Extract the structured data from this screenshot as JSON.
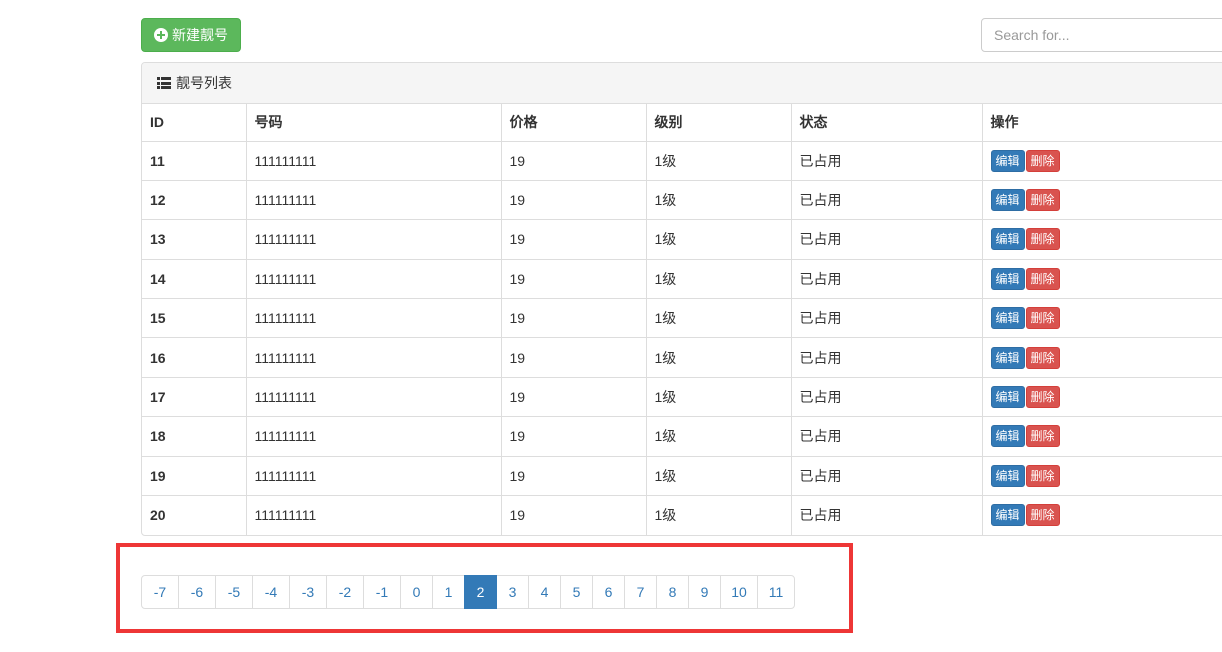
{
  "toolbar": {
    "new_button_label": "新建靓号",
    "search_placeholder": "Search for..."
  },
  "panel": {
    "title": "靓号列表"
  },
  "table": {
    "columns": [
      "ID",
      "号码",
      "价格",
      "级别",
      "状态",
      "操作"
    ],
    "rows": [
      {
        "id": "11",
        "number": "111111111",
        "price": "19",
        "level": "1级",
        "status": "已占用"
      },
      {
        "id": "12",
        "number": "111111111",
        "price": "19",
        "level": "1级",
        "status": "已占用"
      },
      {
        "id": "13",
        "number": "111111111",
        "price": "19",
        "level": "1级",
        "status": "已占用"
      },
      {
        "id": "14",
        "number": "111111111",
        "price": "19",
        "level": "1级",
        "status": "已占用"
      },
      {
        "id": "15",
        "number": "111111111",
        "price": "19",
        "level": "1级",
        "status": "已占用"
      },
      {
        "id": "16",
        "number": "111111111",
        "price": "19",
        "level": "1级",
        "status": "已占用"
      },
      {
        "id": "17",
        "number": "111111111",
        "price": "19",
        "level": "1级",
        "status": "已占用"
      },
      {
        "id": "18",
        "number": "111111111",
        "price": "19",
        "level": "1级",
        "status": "已占用"
      },
      {
        "id": "19",
        "number": "111111111",
        "price": "19",
        "level": "1级",
        "status": "已占用"
      },
      {
        "id": "20",
        "number": "111111111",
        "price": "19",
        "level": "1级",
        "status": "已占用"
      }
    ],
    "edit_label": "编辑",
    "delete_label": "删除"
  },
  "pagination": {
    "pages": [
      "-7",
      "-6",
      "-5",
      "-4",
      "-3",
      "-2",
      "-1",
      "0",
      "1",
      "2",
      "3",
      "4",
      "5",
      "6",
      "7",
      "8",
      "9",
      "10",
      "11"
    ],
    "active": "2"
  },
  "colors": {
    "success": "#5cb85c",
    "primary": "#337ab7",
    "danger": "#d9534f",
    "highlight": "#ee3636"
  },
  "icons": {
    "new_button": "plus-circle-icon",
    "panel_heading": "list-icon"
  }
}
